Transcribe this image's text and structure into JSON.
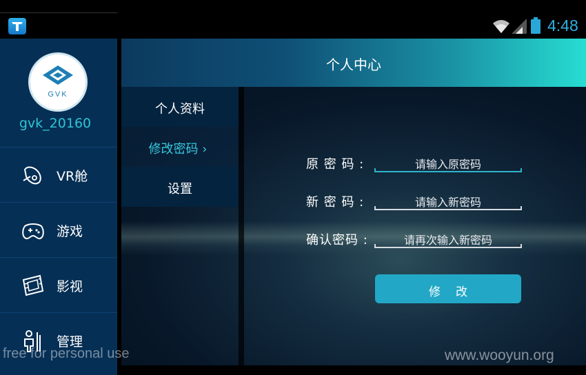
{
  "status_bar": {
    "time": "4:48",
    "icons": [
      "app-icon",
      "wifi-icon",
      "signal-icon",
      "battery-icon"
    ],
    "accent_color": "#2fb0e0"
  },
  "sidebar": {
    "avatar_text": "GVK",
    "username": "gvk_20160",
    "items": [
      {
        "label": "VR舱",
        "icon": "vr-cabin-icon"
      },
      {
        "label": "游戏",
        "icon": "gamepad-icon"
      },
      {
        "label": "影视",
        "icon": "film-icon"
      },
      {
        "label": "管理",
        "icon": "management-icon"
      }
    ]
  },
  "header": {
    "title": "个人中心"
  },
  "submenu": {
    "items": [
      {
        "label": "个人资料",
        "active": false
      },
      {
        "label": "修改密码  ›",
        "active": true
      },
      {
        "label": "设置",
        "active": false
      }
    ]
  },
  "form": {
    "rows": [
      {
        "label": "原 密 码 :",
        "placeholder": "请输入原密码"
      },
      {
        "label": "新 密 码 :",
        "placeholder": "请输入新密码"
      },
      {
        "label": "确认密码 :",
        "placeholder": "请再次输入新密码"
      }
    ],
    "submit_label": "修改"
  },
  "watermarks": {
    "left": "free for personal use",
    "right": "www.wooyun.org"
  },
  "colors": {
    "sidebar_bg": "#062f55",
    "header_gradient_end": "#27ddd2",
    "active_text": "#36c7dd",
    "button_bg": "#22a8c6"
  }
}
